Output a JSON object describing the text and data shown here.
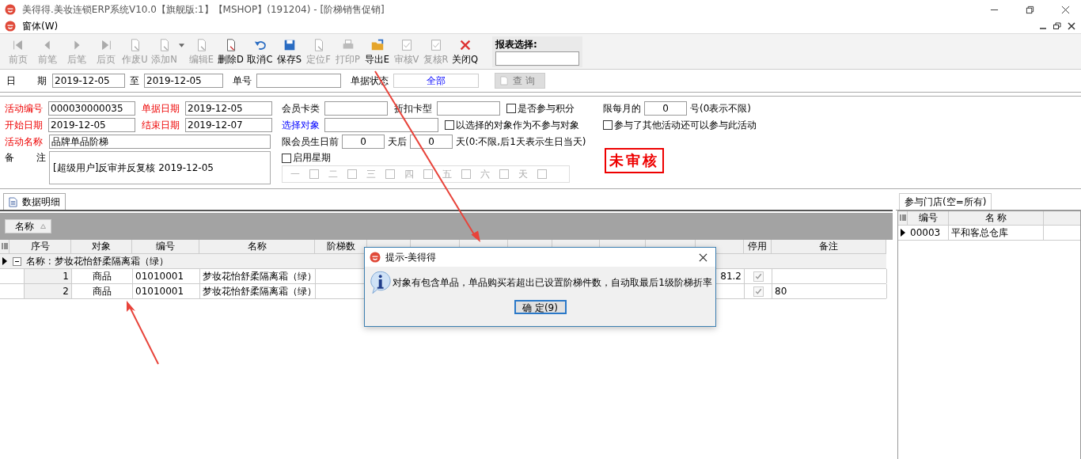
{
  "window": {
    "title": "美得得.美妆连锁ERP系统V10.0【旗舰版:1】【MSHOP】(191204) - [阶梯销售促销]"
  },
  "menu": {
    "label": "窗体(W)"
  },
  "toolbar": [
    {
      "label": "前页",
      "kind": "first",
      "disabled": true
    },
    {
      "label": "前笔",
      "kind": "prev",
      "disabled": true
    },
    {
      "label": "后笔",
      "kind": "next",
      "disabled": true
    },
    {
      "label": "后页",
      "kind": "last",
      "disabled": true
    },
    {
      "label": "作废U",
      "kind": "doc",
      "disabled": true
    },
    {
      "label": "添加N",
      "kind": "doc",
      "disabled": true
    },
    {
      "label": "编辑E",
      "kind": "doc",
      "disabled": true
    },
    {
      "label": "删除D",
      "kind": "doc",
      "disabled": false
    },
    {
      "label": "取消C",
      "kind": "undo",
      "disabled": false
    },
    {
      "label": "保存S",
      "kind": "save",
      "disabled": false
    },
    {
      "label": "定位F",
      "kind": "doc",
      "disabled": true
    },
    {
      "label": "打印P",
      "kind": "print",
      "disabled": true
    },
    {
      "label": "导出E",
      "kind": "export",
      "disabled": false
    },
    {
      "label": "审核V",
      "kind": "check",
      "disabled": true
    },
    {
      "label": "复核R",
      "kind": "check",
      "disabled": true
    },
    {
      "label": "关闭Q",
      "kind": "close",
      "disabled": false
    }
  ],
  "report_select": {
    "label": "报表选择:"
  },
  "filter": {
    "date_label": [
      "日",
      "期"
    ],
    "date_from": "2019-12-05",
    "to_label": "至",
    "date_to": "2019-12-05",
    "number_label": "单号",
    "status_label": "单据状态",
    "status": "全部",
    "query_button": "查 询",
    "query_disabled": true
  },
  "form": {
    "fields": [
      {
        "label": "活动编号",
        "required": true,
        "value": "000030000035"
      },
      {
        "label": "单据日期",
        "required": true,
        "value": "2019-12-05"
      },
      {
        "label": "开始日期",
        "required": true,
        "value": "2019-12-05"
      },
      {
        "label": "结束日期",
        "required": true,
        "value": "2019-12-07"
      }
    ],
    "activity_name": {
      "label": "活动名称",
      "required": true,
      "value": "品牌单品阶梯"
    },
    "remark": {
      "label": [
        "备",
        "注"
      ],
      "value": "[超级用户]反审并反复核 2019-12-05"
    },
    "member_card_label": "会员卡类",
    "discount_card_label": "折扣卡型",
    "points_checkbox": {
      "label": "是否参与积分",
      "checked": false
    },
    "select_target_link": "选择对象",
    "exclude_checkbox": {
      "label": "以选择的对象作为不参与对象",
      "checked": false
    },
    "birthday": {
      "label": "限会员生日前",
      "before": "0",
      "after_label": "天后",
      "after": "0",
      "note": "天(0:不限,后1天表示生日当天)"
    },
    "weekday_checkbox": {
      "label": "启用星期",
      "checked": false
    },
    "weekdays": [
      {
        "label": "一",
        "checked": false
      },
      {
        "label": "二",
        "checked": false
      },
      {
        "label": "三",
        "checked": false
      },
      {
        "label": "四",
        "checked": false
      },
      {
        "label": "五",
        "checked": false
      },
      {
        "label": "六",
        "checked": false
      },
      {
        "label": "天",
        "checked": false
      }
    ],
    "monthly": {
      "label": "限每月的",
      "value": "0",
      "note": "号(0表示不限)"
    },
    "other_activity_checkbox": {
      "label": "参与了其他活动还可以参与此活动",
      "checked": false
    },
    "stamp": "未审核"
  },
  "tabs": [
    {
      "label": "数据明细",
      "selected": true
    }
  ],
  "group_by": {
    "label": "名称"
  },
  "grid": {
    "columns": [
      "序号",
      "对象",
      "编号",
      "名称",
      "阶梯数"
    ],
    "columns_right": [
      "停用",
      "备注"
    ],
    "group": {
      "label": "名称 : 梦妆花怡舒柔隔离霜（绿）",
      "expanded": true
    },
    "rows": [
      {
        "index": "1",
        "target": "商品",
        "code": "01010001",
        "name": "梦妆花怡舒柔隔离霜（绿）",
        "last_price": "81.2",
        "stopped": true
      },
      {
        "index": "2",
        "target": "商品",
        "code": "01010001",
        "name": "梦妆花怡舒柔隔离霜（绿）",
        "stopped": true,
        "remark": "80"
      }
    ]
  },
  "stores": {
    "tab": "参与门店(空=所有)",
    "columns": [
      "编号",
      "名 称"
    ],
    "rows": [
      {
        "code": "00003",
        "name": "平和客总仓库",
        "selected": true
      }
    ]
  },
  "dialog": {
    "title": "提示-美得得",
    "message": "对象有包含单品，单品购买若超出已设置阶梯件数，自动取最后1级阶梯折率",
    "button": "确 定(9)"
  }
}
